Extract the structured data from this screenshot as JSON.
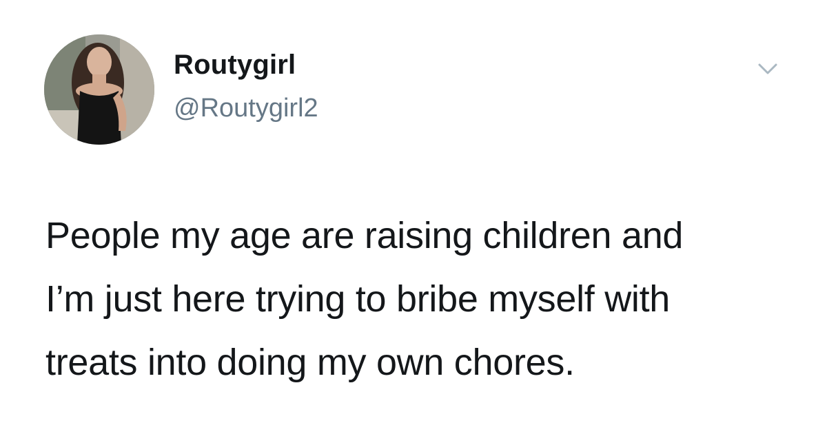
{
  "tweet": {
    "author": {
      "display_name": "Routygirl",
      "handle": "@Routygirl2",
      "avatar_icon": "profile-photo"
    },
    "menu_icon": "chevron-down-icon",
    "text_lines": [
      "People my age are raising children and",
      "I’m just here trying to bribe myself with",
      "treats into doing my own chores."
    ]
  },
  "colors": {
    "background": "#ffffff",
    "primary_text": "#14171a",
    "secondary_text": "#657786",
    "icon": "#aab8c2"
  }
}
